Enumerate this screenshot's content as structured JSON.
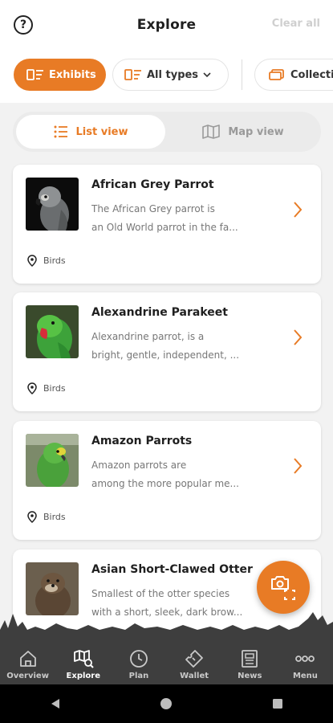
{
  "header": {
    "title": "Explore",
    "clear_all": "Clear all",
    "help_icon": "question-circle-icon"
  },
  "filters": {
    "exhibits": "Exhibits",
    "all_types": "All types",
    "collections": "Collecti"
  },
  "view_toggle": {
    "list": "List view",
    "map": "Map view",
    "selected": "list"
  },
  "cards": [
    {
      "title": "African Grey Parrot",
      "desc_line1": "The African Grey parrot is",
      "desc_line2": "an Old World parrot in the fa...",
      "category": "Birds"
    },
    {
      "title": "Alexandrine Parakeet",
      "desc_line1": "Alexandrine parrot, is a",
      "desc_line2": "bright, gentle, independent, ...",
      "category": "Birds"
    },
    {
      "title": "Amazon Parrots",
      "desc_line1": "Amazon parrots are",
      "desc_line2": "among the more popular me...",
      "category": "Birds"
    },
    {
      "title": "Asian Short-Clawed Otter",
      "desc_line1": "Smallest of the otter species",
      "desc_line2": "with a short, sleek, dark brow...",
      "category": ""
    }
  ],
  "tabs": [
    {
      "label": "Overview",
      "icon": "home-icon"
    },
    {
      "label": "Explore",
      "icon": "map-search-icon",
      "active": true
    },
    {
      "label": "Plan",
      "icon": "clock-icon"
    },
    {
      "label": "Wallet",
      "icon": "ticket-icon"
    },
    {
      "label": "News",
      "icon": "newspaper-icon"
    },
    {
      "label": "Menu",
      "icon": "more-dots-icon"
    }
  ],
  "colors": {
    "accent": "#e87b25",
    "tabbar": "#3e3e3e",
    "background": "#f2f2f2"
  }
}
